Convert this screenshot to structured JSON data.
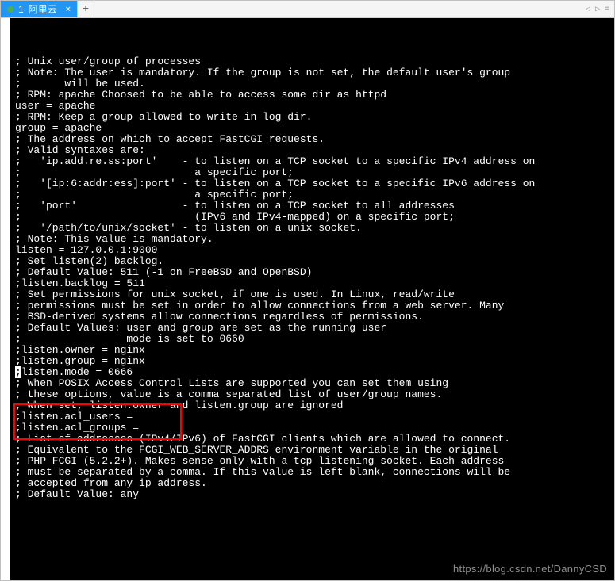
{
  "tab": {
    "index": "1",
    "label": "阿里云",
    "close_glyph": "×",
    "new_glyph": "+"
  },
  "nav": {
    "left": "◁",
    "right": "▷",
    "menu": "≡"
  },
  "terminal": {
    "lines": [
      "; Unix user/group of processes",
      "; Note: The user is mandatory. If the group is not set, the default user's group",
      ";       will be used.",
      "; RPM: apache Choosed to be able to access some dir as httpd",
      "user = apache",
      "; RPM: Keep a group allowed to write in log dir.",
      "group = apache",
      "",
      "; The address on which to accept FastCGI requests.",
      "; Valid syntaxes are:",
      ";   'ip.add.re.ss:port'    - to listen on a TCP socket to a specific IPv4 address on",
      ";                            a specific port;",
      ";   '[ip:6:addr:ess]:port' - to listen on a TCP socket to a specific IPv6 address on",
      ";                            a specific port;",
      ";   'port'                 - to listen on a TCP socket to all addresses",
      ";                            (IPv6 and IPv4-mapped) on a specific port;",
      ";   '/path/to/unix/socket' - to listen on a unix socket.",
      "; Note: This value is mandatory.",
      "listen = 127.0.0.1:9000",
      "",
      "; Set listen(2) backlog.",
      "; Default Value: 511 (-1 on FreeBSD and OpenBSD)",
      ";listen.backlog = 511",
      "",
      "; Set permissions for unix socket, if one is used. In Linux, read/write",
      "; permissions must be set in order to allow connections from a web server. Many",
      "; BSD-derived systems allow connections regardless of permissions.",
      "; Default Values: user and group are set as the running user",
      ";                 mode is set to 0660",
      ";listen.owner = nginx",
      ";listen.group = nginx",
      ";listen.mode = 0666",
      "; When POSIX Access Control Lists are supported you can set them using",
      "; these options, value is a comma separated list of user/group names.",
      "; When set, listen.owner and listen.group are ignored",
      ";listen.acl_users =",
      ";listen.acl_groups =",
      "",
      "; List of addresses (IPv4/IPv6) of FastCGI clients which are allowed to connect.",
      "; Equivalent to the FCGI_WEB_SERVER_ADDRS environment variable in the original",
      "; PHP FCGI (5.2.2+). Makes sense only with a tcp listening socket. Each address",
      "; must be separated by a comma. If this value is left blank, connections will be",
      "; accepted from any ip address.",
      "; Default Value: any"
    ],
    "cursor_line_index": 31,
    "cursor_char": ";"
  },
  "watermark": "https://blog.csdn.net/DannyCSD"
}
